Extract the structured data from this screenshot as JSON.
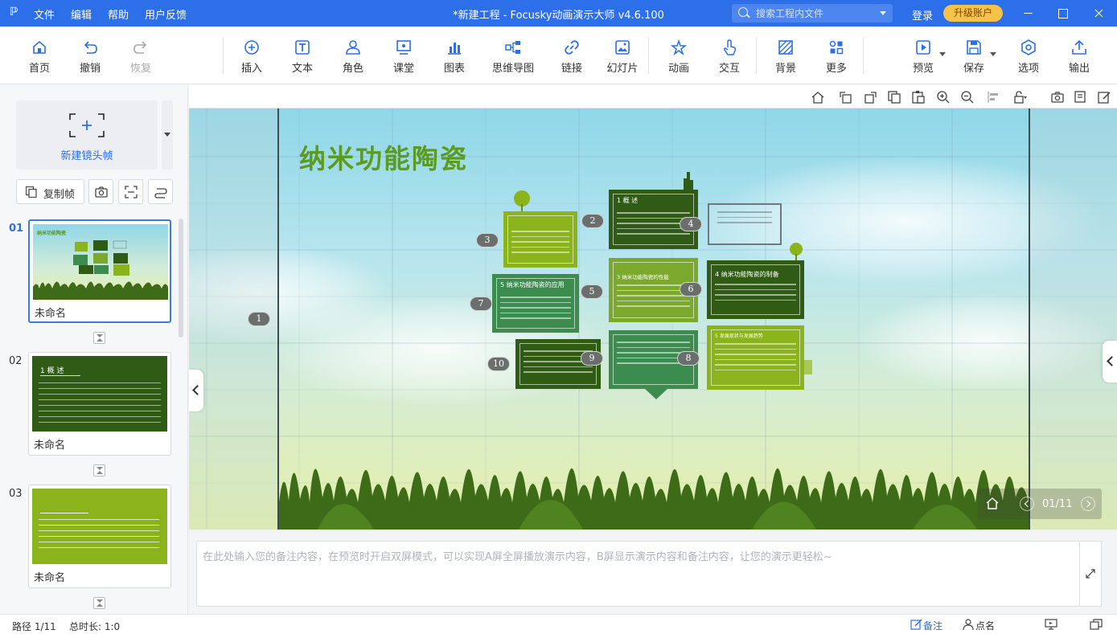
{
  "app": {
    "logo": "ℙ",
    "menu": [
      "文件",
      "编辑",
      "帮助",
      "用户反馈"
    ],
    "title": "*新建工程 - Focusky动画演示大师  v4.6.100",
    "search_placeholder": "搜索工程内文件",
    "login": "登录",
    "upgrade": "升级账户",
    "accent": "#2d6fe8"
  },
  "toolbar": {
    "home": "首页",
    "undo": "撤销",
    "redo": "恢复",
    "insert": "插入",
    "text": "文本",
    "role": "角色",
    "class": "课堂",
    "chart": "图表",
    "mindmap": "思维导图",
    "link": "链接",
    "slideshow": "幻灯片",
    "animation": "动画",
    "interact": "交互",
    "background": "背景",
    "more": "更多",
    "preview": "预览",
    "save": "保存",
    "options": "选项",
    "export": "输出"
  },
  "sidebar": {
    "new_frame": "新建镜头帧",
    "copy_frame": "复制帧",
    "slides": [
      {
        "num": "01",
        "name": "未命名",
        "thumb_title": "纳米功能陶瓷"
      },
      {
        "num": "02",
        "name": "未命名",
        "thumb_title": "1 概 述"
      },
      {
        "num": "03",
        "name": "未命名",
        "thumb_title": ""
      }
    ]
  },
  "canvas": {
    "slide_title": "纳米功能陶瓷",
    "counter": "01/11",
    "boxes": {
      "b1_head": "1 概 述",
      "b3_head": "3 纳米功能陶瓷的性能",
      "b4_head": "4 纳米功能陶瓷的制备",
      "b5_head": "5 纳米功能陶瓷的应用",
      "b6_head": "5 发展现状与发展趋势"
    },
    "numbers": [
      "1",
      "2",
      "3",
      "4",
      "5",
      "6",
      "7",
      "8",
      "9",
      "10"
    ]
  },
  "notes": {
    "placeholder": "在此处输入您的备注内容，在预览时开启双屏模式，可以实现A屏全屏播放演示内容，B屏显示演示内容和备注内容，让您的演示更轻松~"
  },
  "status": {
    "path": "路径 1/11",
    "duration": "总时长: 1:0",
    "notes_btn": "备注",
    "rollcall_btn": "点名"
  }
}
